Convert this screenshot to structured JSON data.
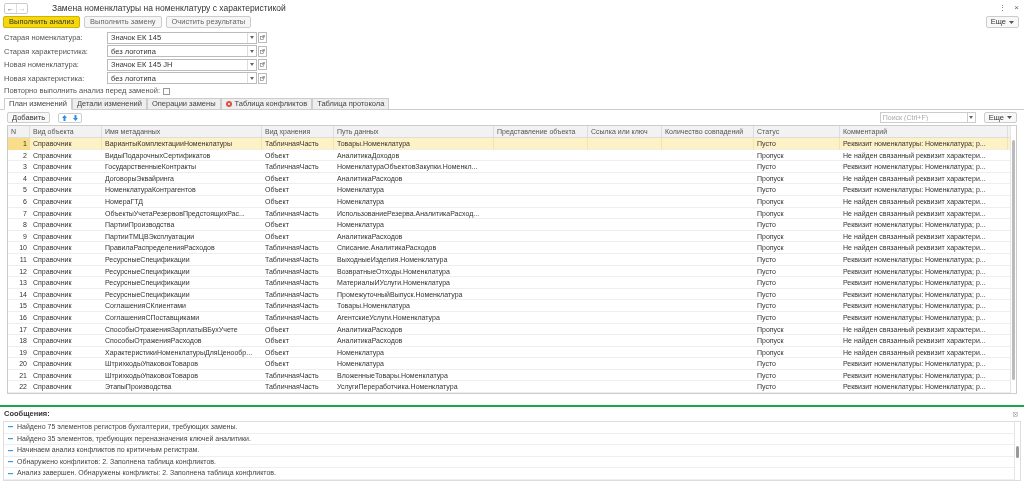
{
  "window": {
    "title": "Замена номенклатуры на номенклатуру с характеристикой"
  },
  "nav": {
    "back": "←",
    "forward": "→"
  },
  "window_controls": {
    "menu": "⋮",
    "close": "×"
  },
  "commands": [
    {
      "label": "Выполнить анализ",
      "kind": "primary"
    },
    {
      "label": "Выполнить замену",
      "kind": "normal"
    },
    {
      "label": "Очистить результаты",
      "kind": "normal"
    }
  ],
  "more_button": "Еще",
  "fields": [
    {
      "label": "Старая номенклатура:",
      "value": "Значок ЕК 145"
    },
    {
      "label": "Старая характеристика:",
      "value": "без логотипа"
    },
    {
      "label": "Новая номенклатура:",
      "value": "Значок ЕК 145 JH"
    },
    {
      "label": "Новая характеристика:",
      "value": "без логотипа"
    }
  ],
  "repeat_analysis": {
    "label": "Повторно выполнить анализ перед заменой:",
    "checked": false
  },
  "tabs": [
    {
      "label": "План изменений",
      "selected": true,
      "error": false
    },
    {
      "label": "Детали изменений",
      "selected": false,
      "error": false
    },
    {
      "label": "Операции замены",
      "selected": false,
      "error": false
    },
    {
      "label": "Таблица конфликтов",
      "selected": false,
      "error": true
    },
    {
      "label": "Таблица протокола",
      "selected": false,
      "error": false
    }
  ],
  "toolbar": {
    "add": "Добавить",
    "search_placeholder": "Поиск (Ctrl+F)",
    "more": "Еще"
  },
  "table": {
    "columns": [
      "N",
      "Вид объекта",
      "Имя метаданных",
      "Вид хранения",
      "Путь данных",
      "Представление объекта",
      "Ссылка или ключ",
      "Количество совпадений",
      "Статус",
      "Комментарий"
    ],
    "rows": [
      {
        "n": "1",
        "type": "Справочник",
        "meta": "ВариантыКомплектацииНоменклатуры",
        "storage": "ТабличнаяЧасть",
        "path": "Товары.Номенклатура",
        "status": "Пусто",
        "comment": "Реквизит номенклатуры: Номенклатура; р...",
        "selected": true
      },
      {
        "n": "2",
        "type": "Справочник",
        "meta": "ВидыПодарочныхСертификатов",
        "storage": "Объект",
        "path": "АналитикаДоходов",
        "status": "Пропуск",
        "comment": "Не найден связанный реквизит характери...",
        "selected": false
      },
      {
        "n": "3",
        "type": "Справочник",
        "meta": "ГосударственныеКонтракты",
        "storage": "ТабличнаяЧасть",
        "path": "НоменклатураОбъектовЗакупки.Номенкл...",
        "status": "Пусто",
        "comment": "Реквизит номенклатуры: Номенклатура; р...",
        "selected": false
      },
      {
        "n": "4",
        "type": "Справочник",
        "meta": "ДоговорыЭквайринга",
        "storage": "Объект",
        "path": "АналитикаРасходов",
        "status": "Пропуск",
        "comment": "Не найден связанный реквизит характери...",
        "selected": false
      },
      {
        "n": "5",
        "type": "Справочник",
        "meta": "НоменклатураКонтрагентов",
        "storage": "Объект",
        "path": "Номенклатура",
        "status": "Пусто",
        "comment": "Реквизит номенклатуры: Номенклатура; р...",
        "selected": false
      },
      {
        "n": "6",
        "type": "Справочник",
        "meta": "НомераГТД",
        "storage": "Объект",
        "path": "Номенклатура",
        "status": "Пропуск",
        "comment": "Не найден связанный реквизит характери...",
        "selected": false
      },
      {
        "n": "7",
        "type": "Справочник",
        "meta": "ОбъектыУчетаРезервовПредстоящихРас...",
        "storage": "ТабличнаяЧасть",
        "path": "ИспользованиеРезерва.АналитикаРасход...",
        "status": "Пропуск",
        "comment": "Не найден связанный реквизит характери...",
        "selected": false
      },
      {
        "n": "8",
        "type": "Справочник",
        "meta": "ПартииПроизводства",
        "storage": "Объект",
        "path": "Номенклатура",
        "status": "Пусто",
        "comment": "Реквизит номенклатуры: Номенклатура; р...",
        "selected": false
      },
      {
        "n": "9",
        "type": "Справочник",
        "meta": "ПартииТМЦВЭксплуатации",
        "storage": "Объект",
        "path": "АналитикаРасходов",
        "status": "Пропуск",
        "comment": "Не найден связанный реквизит характери...",
        "selected": false
      },
      {
        "n": "10",
        "type": "Справочник",
        "meta": "ПравилаРаспределенияРасходов",
        "storage": "ТабличнаяЧасть",
        "path": "Списание.АналитикаРасходов",
        "status": "Пропуск",
        "comment": "Не найден связанный реквизит характери...",
        "selected": false
      },
      {
        "n": "11",
        "type": "Справочник",
        "meta": "РесурсныеСпецификации",
        "storage": "ТабличнаяЧасть",
        "path": "ВыходныеИзделия.Номенклатура",
        "status": "Пусто",
        "comment": "Реквизит номенклатуры: Номенклатура; р...",
        "selected": false
      },
      {
        "n": "12",
        "type": "Справочник",
        "meta": "РесурсныеСпецификации",
        "storage": "ТабличнаяЧасть",
        "path": "ВозвратныеОтходы.Номенклатура",
        "status": "Пусто",
        "comment": "Реквизит номенклатуры: Номенклатура; р...",
        "selected": false
      },
      {
        "n": "13",
        "type": "Справочник",
        "meta": "РесурсныеСпецификации",
        "storage": "ТабличнаяЧасть",
        "path": "МатериалыИУслуги.Номенклатура",
        "status": "Пусто",
        "comment": "Реквизит номенклатуры: Номенклатура; р...",
        "selected": false
      },
      {
        "n": "14",
        "type": "Справочник",
        "meta": "РесурсныеСпецификации",
        "storage": "ТабличнаяЧасть",
        "path": "ПромежуточныйВыпуск.Номенклатура",
        "status": "Пусто",
        "comment": "Реквизит номенклатуры: Номенклатура; р...",
        "selected": false
      },
      {
        "n": "15",
        "type": "Справочник",
        "meta": "СоглашенияСКлиентами",
        "storage": "ТабличнаяЧасть",
        "path": "Товары.Номенклатура",
        "status": "Пусто",
        "comment": "Реквизит номенклатуры: Номенклатура; р...",
        "selected": false
      },
      {
        "n": "16",
        "type": "Справочник",
        "meta": "СоглашенияСПоставщиками",
        "storage": "ТабличнаяЧасть",
        "path": "АгентскиеУслуги.Номенклатура",
        "status": "Пусто",
        "comment": "Реквизит номенклатуры: Номенклатура; р...",
        "selected": false
      },
      {
        "n": "17",
        "type": "Справочник",
        "meta": "СпособыОтраженияЗарплатыВБухУчете",
        "storage": "Объект",
        "path": "АналитикаРасходов",
        "status": "Пропуск",
        "comment": "Не найден связанный реквизит характери...",
        "selected": false
      },
      {
        "n": "18",
        "type": "Справочник",
        "meta": "СпособыОтраженияРасходов",
        "storage": "Объект",
        "path": "АналитикаРасходов",
        "status": "Пропуск",
        "comment": "Не найден связанный реквизит характери...",
        "selected": false
      },
      {
        "n": "19",
        "type": "Справочник",
        "meta": "ХарактеристикиНоменклатурыДляЦенообр...",
        "storage": "Объект",
        "path": "Номенклатура",
        "status": "Пропуск",
        "comment": "Не найден связанный реквизит характери...",
        "selected": false
      },
      {
        "n": "20",
        "type": "Справочник",
        "meta": "ШтрихкодыУпаковокТоваров",
        "storage": "Объект",
        "path": "Номенклатура",
        "status": "Пусто",
        "comment": "Реквизит номенклатуры: Номенклатура; р...",
        "selected": false
      },
      {
        "n": "21",
        "type": "Справочник",
        "meta": "ШтрихкодыУпаковокТоваров",
        "storage": "ТабличнаяЧасть",
        "path": "ВложенныеТовары.Номенклатура",
        "status": "Пусто",
        "comment": "Реквизит номенклатуры: Номенклатура; р...",
        "selected": false
      },
      {
        "n": "22",
        "type": "Справочник",
        "meta": "ЭтапыПроизводства",
        "storage": "ТабличнаяЧасть",
        "path": "УслугиПереработчика.Номенклатура",
        "status": "Пусто",
        "comment": "Реквизит номенклатуры: Номенклатура; р...",
        "selected": false
      }
    ]
  },
  "messages": {
    "title": "Сообщения:",
    "items": [
      "Найдено 75 элементов регистров бухгалтерии, требующих замены.",
      "Найдено 35 элементов, требующих переназначения ключей аналитики.",
      "Начинаем анализ конфликтов по критичным регистрам.",
      "Обнаружено конфликтов: 2. Заполнена таблица конфликтов.",
      "Анализ завершен. Обнаружены конфликты: 2. Заполнена таблица конфликтов."
    ]
  }
}
